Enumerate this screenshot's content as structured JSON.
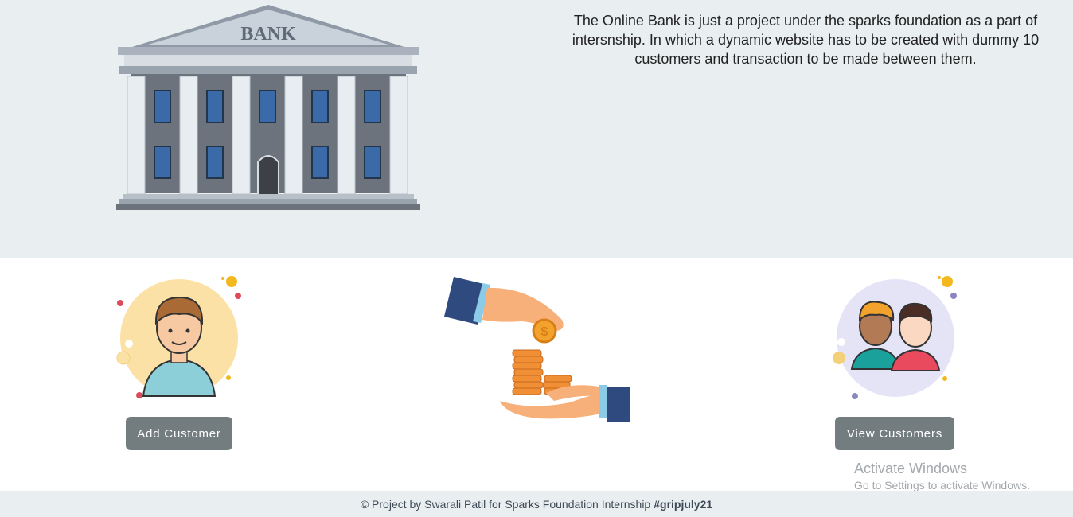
{
  "hero": {
    "bank_sign": "BANK",
    "description": "The Online Bank is just a project under the sparks foundation as a part of intersnship. In which a dynamic website has to be created with dummy 10 customers and transaction to be made between them."
  },
  "actions": {
    "add_customer_label": "Add Customer",
    "view_customers_label": "View Customers"
  },
  "watermark": {
    "title": "Activate Windows",
    "subtitle": "Go to Settings to activate Windows."
  },
  "footer": {
    "text": "© Project by Swarali Patil for Sparks Foundation Internship",
    "hashtag": "#gripjuly21"
  },
  "colors": {
    "hero_bg": "#e9eef1",
    "button_bg": "#737d7f",
    "footer_bg": "#e9eef1"
  },
  "icons": [
    "bank-building-illustration",
    "customer-avatar-icon",
    "coins-exchange-illustration",
    "customers-group-icon"
  ]
}
